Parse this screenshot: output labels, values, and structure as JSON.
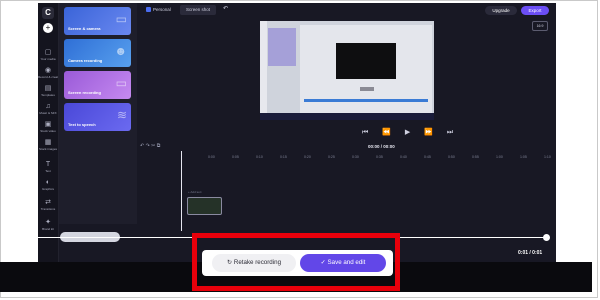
{
  "header": {
    "workspace": "Personal",
    "project_title": "Screen shot",
    "upgrade": "Upgrade",
    "export": "Export",
    "aspect_ratio": "16:9"
  },
  "rail": {
    "logo": "C",
    "add": "+",
    "items": [
      {
        "icon": "▢",
        "label": "Your media"
      },
      {
        "icon": "◉",
        "label": "Record & create"
      },
      {
        "icon": "▤",
        "label": "Templates"
      },
      {
        "icon": "♫",
        "label": "Music & SFX"
      },
      {
        "icon": "▣",
        "label": "Stock video"
      },
      {
        "icon": "▦",
        "label": "Stock images"
      },
      {
        "icon": "T",
        "label": "Text"
      },
      {
        "icon": "◐",
        "label": "Graphics"
      },
      {
        "icon": "⇄",
        "label": "Transitions"
      },
      {
        "icon": "✦",
        "label": "Brand kit"
      }
    ]
  },
  "record_panel": {
    "tiles": [
      {
        "label": "Screen & camera"
      },
      {
        "label": "Camera recording"
      },
      {
        "label": "Screen recording"
      },
      {
        "label": "Text to speech"
      }
    ]
  },
  "playback": {
    "controls": "⏮ ⏪ ▶ ⏩ ⏭"
  },
  "help": "?",
  "timeline": {
    "tools": "↶ ↷ ✂ ⧉",
    "time": "00:00 / 00:00",
    "ruler": [
      "0:00",
      "0:05",
      "0:10",
      "0:15",
      "0:20",
      "0:25",
      "0:30",
      "0:35",
      "0:40",
      "0:45",
      "0:50",
      "0:55",
      "1:00",
      "1:05",
      "1:10"
    ],
    "track_label": "+ Add text"
  },
  "time_readout": "0:01 / 0:01",
  "overlay": {
    "retake_label": "Retake recording",
    "save_label": "Save and edit"
  },
  "colors": {
    "accent": "#6247e8",
    "highlight": "#e8000b",
    "background": "#181824"
  }
}
